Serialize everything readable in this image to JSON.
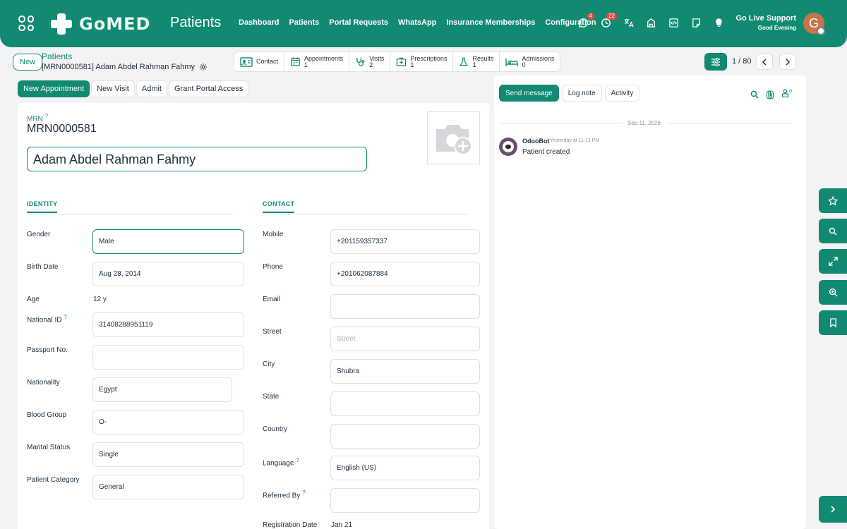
{
  "topbar": {
    "logo_text": "GoMED",
    "app_title": "Patients",
    "nav": [
      "Dashboard",
      "Patients",
      "Portal Requests",
      "WhatsApp",
      "Insurance Memberships",
      "Configuration"
    ],
    "messages_badge": "4",
    "activities_badge": "22",
    "support_title": "Go Live Support",
    "support_greeting": "Good Evening",
    "avatar_letter": "G"
  },
  "control": {
    "new_label": "New",
    "breadcrumb_parent": "Patients",
    "breadcrumb_current": "[MRN0000581] Adam Abdel Rahman Fahmy",
    "smart_buttons": [
      {
        "label": "Contact",
        "value": ""
      },
      {
        "label": "Appointments",
        "value": "1"
      },
      {
        "label": "Visits",
        "value": "2"
      },
      {
        "label": "Prescriptions",
        "value": "1"
      },
      {
        "label": "Results",
        "value": "1"
      },
      {
        "label": "Admissions",
        "value": "0"
      }
    ],
    "pager": "1 / 80"
  },
  "actions": [
    "New Appointment",
    "New Visit",
    "Admit",
    "Grant Portal Access"
  ],
  "form": {
    "mrn_label": "MRN",
    "mrn_help": "?",
    "mrn_value": "MRN0000581",
    "patient_name": "Adam Abdel Rahman Fahmy",
    "identity_title": "IDENTITY",
    "contact_title": "CONTACT",
    "gender": {
      "label": "Gender",
      "value": "Male"
    },
    "birth_date": {
      "label": "Birth Date",
      "value": "Aug 28, 2014"
    },
    "age": {
      "label": "Age",
      "value": "12 y"
    },
    "national_id": {
      "label": "National ID",
      "value": "31408288951119"
    },
    "passport": {
      "label": "Passport No.",
      "value": ""
    },
    "nationality": {
      "label": "Nationality",
      "value": "Egypt"
    },
    "blood_group": {
      "label": "Blood Group",
      "value": "O-"
    },
    "marital_status": {
      "label": "Marital Status",
      "value": "Single"
    },
    "patient_category": {
      "label": "Patient Category",
      "value": "General"
    },
    "mobile": {
      "label": "Mobile",
      "value": "+201159357337"
    },
    "phone": {
      "label": "Phone",
      "value": "+201062087884"
    },
    "email": {
      "label": "Email",
      "value": ""
    },
    "street": {
      "label": "Street",
      "placeholder": "Street"
    },
    "city": {
      "label": "City",
      "value": "Shubra"
    },
    "state": {
      "label": "State",
      "value": ""
    },
    "country": {
      "label": "Country",
      "value": ""
    },
    "language": {
      "label": "Language",
      "value": "English (US)"
    },
    "referred_by": {
      "label": "Referred By",
      "value": ""
    },
    "registration_date": {
      "label": "Registration Date",
      "value": "Jan 21"
    }
  },
  "chatter": {
    "send_message": "Send message",
    "log_note": "Log note",
    "activity": "Activity",
    "followers_count": "0",
    "date": "Sep 11, 2026",
    "message": {
      "author": "OdooBot",
      "time": "Yesterday at 11:13 PM",
      "body": "Patient created"
    }
  },
  "colors": {
    "primary": "#128a72",
    "badge": "#e8473b"
  }
}
